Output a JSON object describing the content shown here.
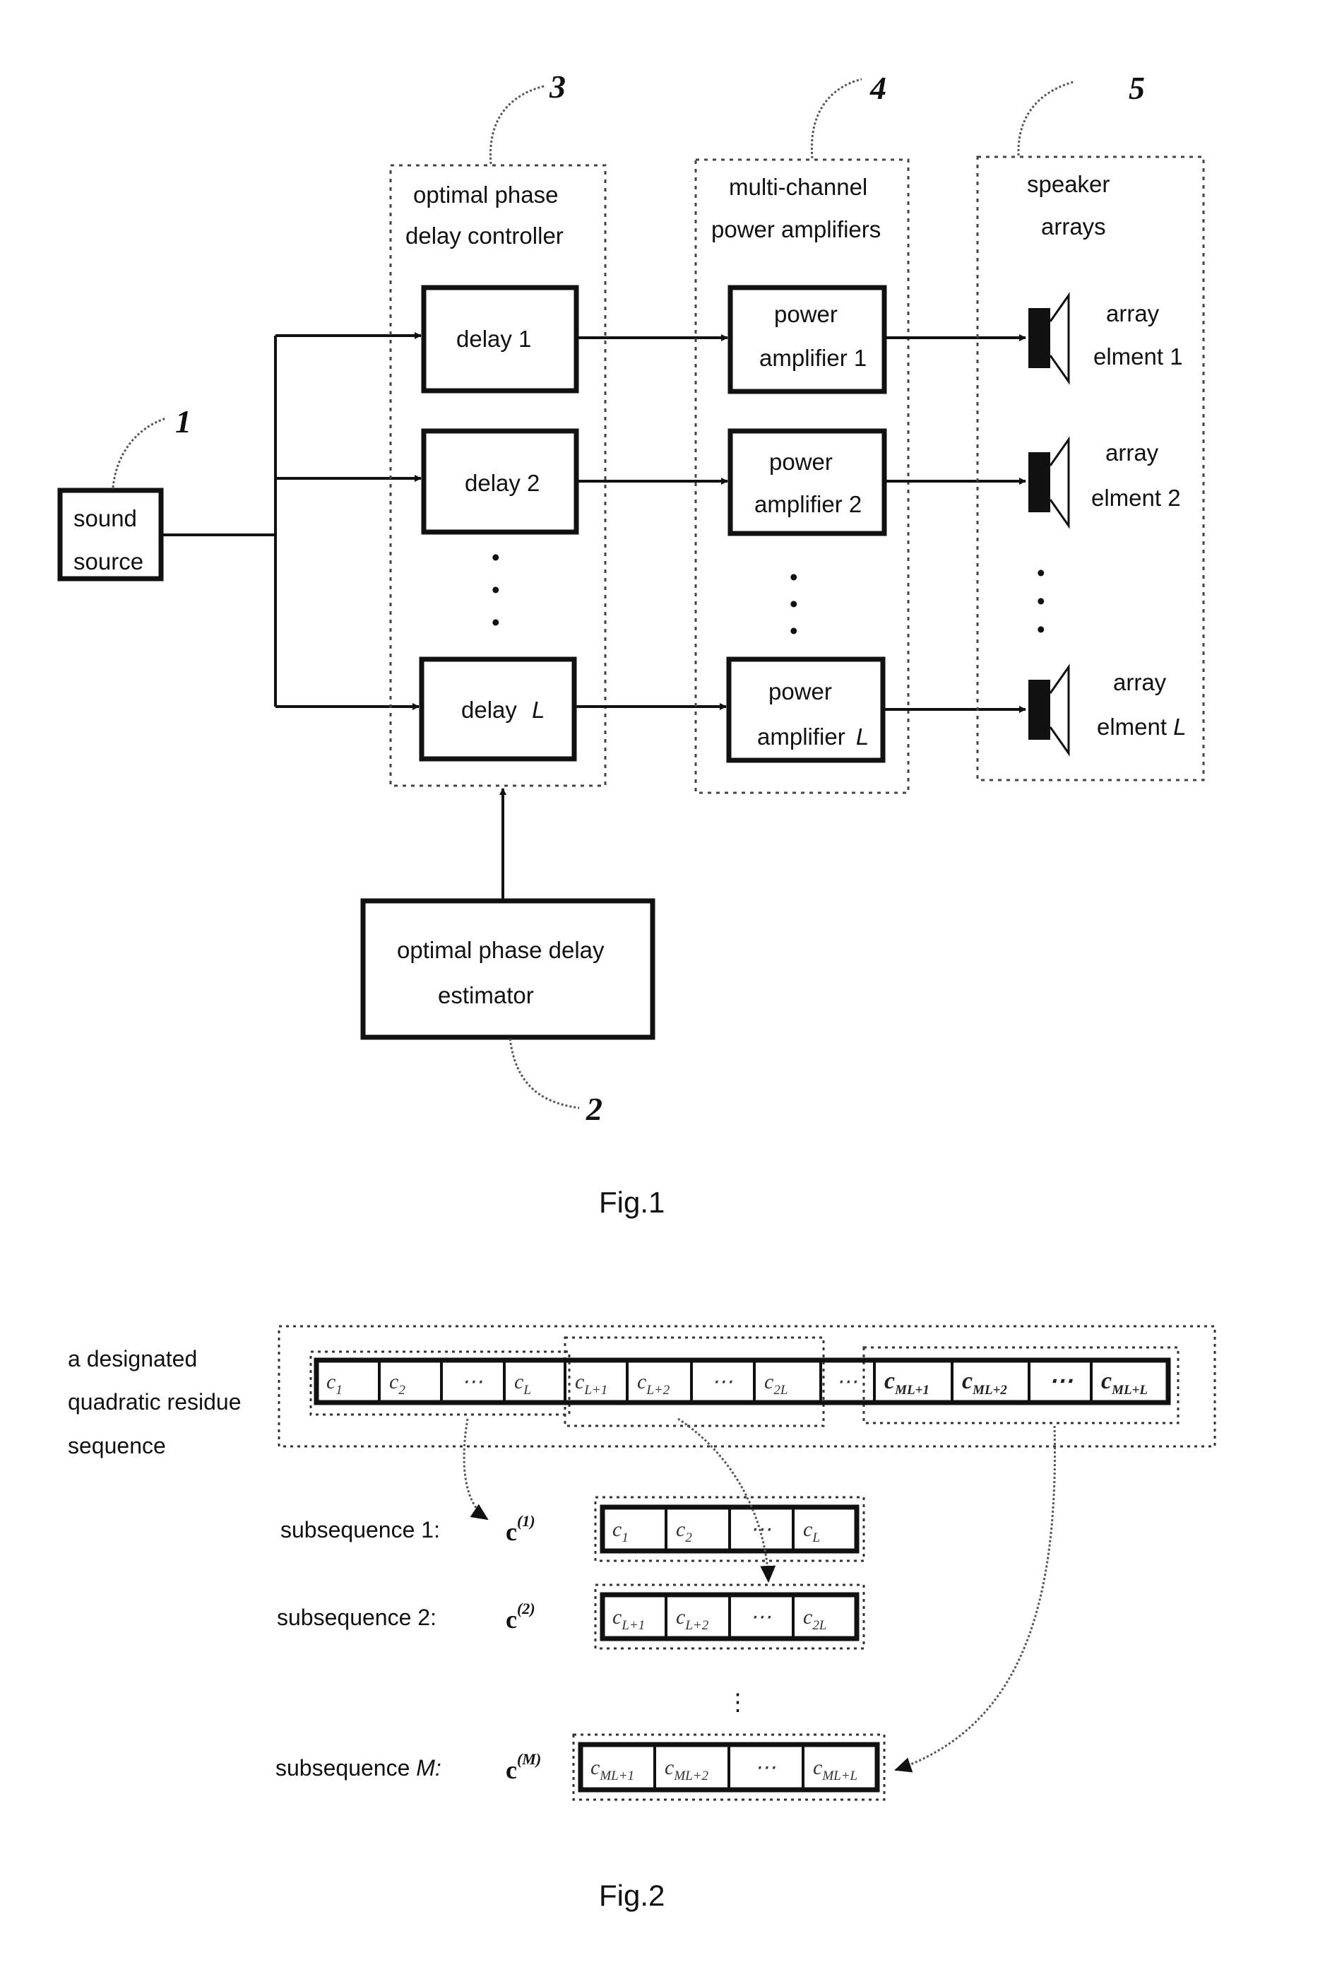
{
  "fig1": {
    "caption": "Fig.1",
    "sound_source": {
      "ref": "1",
      "line1": "sound",
      "line2": "source"
    },
    "estimator": {
      "ref": "2",
      "line1": "optimal phase delay",
      "line2": "estimator"
    },
    "controller": {
      "ref": "3",
      "title1": "optimal phase",
      "title2": "delay controller",
      "blocks": [
        {
          "label": "delay 1",
          "index": ""
        },
        {
          "label": "delay 2",
          "index": ""
        },
        {
          "label": "delay ",
          "index": "L"
        }
      ]
    },
    "amplifiers": {
      "ref": "4",
      "title1": "multi-channel",
      "title2": "power amplifiers",
      "blocks": [
        {
          "line1": "power",
          "line2": "amplifier  1",
          "index": ""
        },
        {
          "line1": "power",
          "line2": "amplifier 2",
          "index": ""
        },
        {
          "line1": "power",
          "line2": "amplifier ",
          "index": "L"
        }
      ]
    },
    "speakers": {
      "ref": "5",
      "title1": "speaker",
      "title2": "arrays",
      "elements": [
        {
          "line1": "array",
          "line2": "elment 1",
          "index": ""
        },
        {
          "line1": "array",
          "line2": "elment 2",
          "index": ""
        },
        {
          "line1": "array",
          "line2": "elment ",
          "index": "L"
        }
      ]
    },
    "ellipsis": "•"
  },
  "fig2": {
    "caption": "Fig.2",
    "sequence_label": [
      "a designated",
      "quadratic residue",
      "sequence"
    ],
    "sequence_cells": [
      {
        "base": "c",
        "sub": "1"
      },
      {
        "base": "c",
        "sub": "2"
      },
      {
        "base": "⋯",
        "sub": ""
      },
      {
        "base": "c",
        "sub": "L"
      },
      {
        "base": "c",
        "sub": "L+1"
      },
      {
        "base": "c",
        "sub": "L+2"
      },
      {
        "base": "⋯",
        "sub": ""
      },
      {
        "base": "c",
        "sub": "2L"
      },
      {
        "base": "⋯",
        "sub": ""
      },
      {
        "base": "c",
        "sub": "ML+1"
      },
      {
        "base": "c",
        "sub": "ML+2"
      },
      {
        "base": "⋯",
        "sub": ""
      },
      {
        "base": "c",
        "sub": "ML+L"
      }
    ],
    "subsequences": [
      {
        "label": "subsequence 1:",
        "label_index": "",
        "vector": "c",
        "sup": "(1)",
        "cells": [
          {
            "base": "c",
            "sub": "1"
          },
          {
            "base": "c",
            "sub": "2"
          },
          {
            "base": "⋯",
            "sub": ""
          },
          {
            "base": "c",
            "sub": "L"
          }
        ]
      },
      {
        "label": "subsequence 2:",
        "label_index": "",
        "vector": "c",
        "sup": "(2)",
        "cells": [
          {
            "base": "c",
            "sub": "L+1"
          },
          {
            "base": "c",
            "sub": "L+2"
          },
          {
            "base": "⋯",
            "sub": ""
          },
          {
            "base": "c",
            "sub": "2L"
          }
        ]
      },
      {
        "label": "subsequence ",
        "label_index": "M:",
        "vector": "c",
        "sup": "(M)",
        "cells": [
          {
            "base": "c",
            "sub": "ML+1"
          },
          {
            "base": "c",
            "sub": "ML+2"
          },
          {
            "base": "⋯",
            "sub": ""
          },
          {
            "base": "c",
            "sub": "ML+L"
          }
        ]
      }
    ],
    "vertical_ellipsis": "⋮"
  }
}
